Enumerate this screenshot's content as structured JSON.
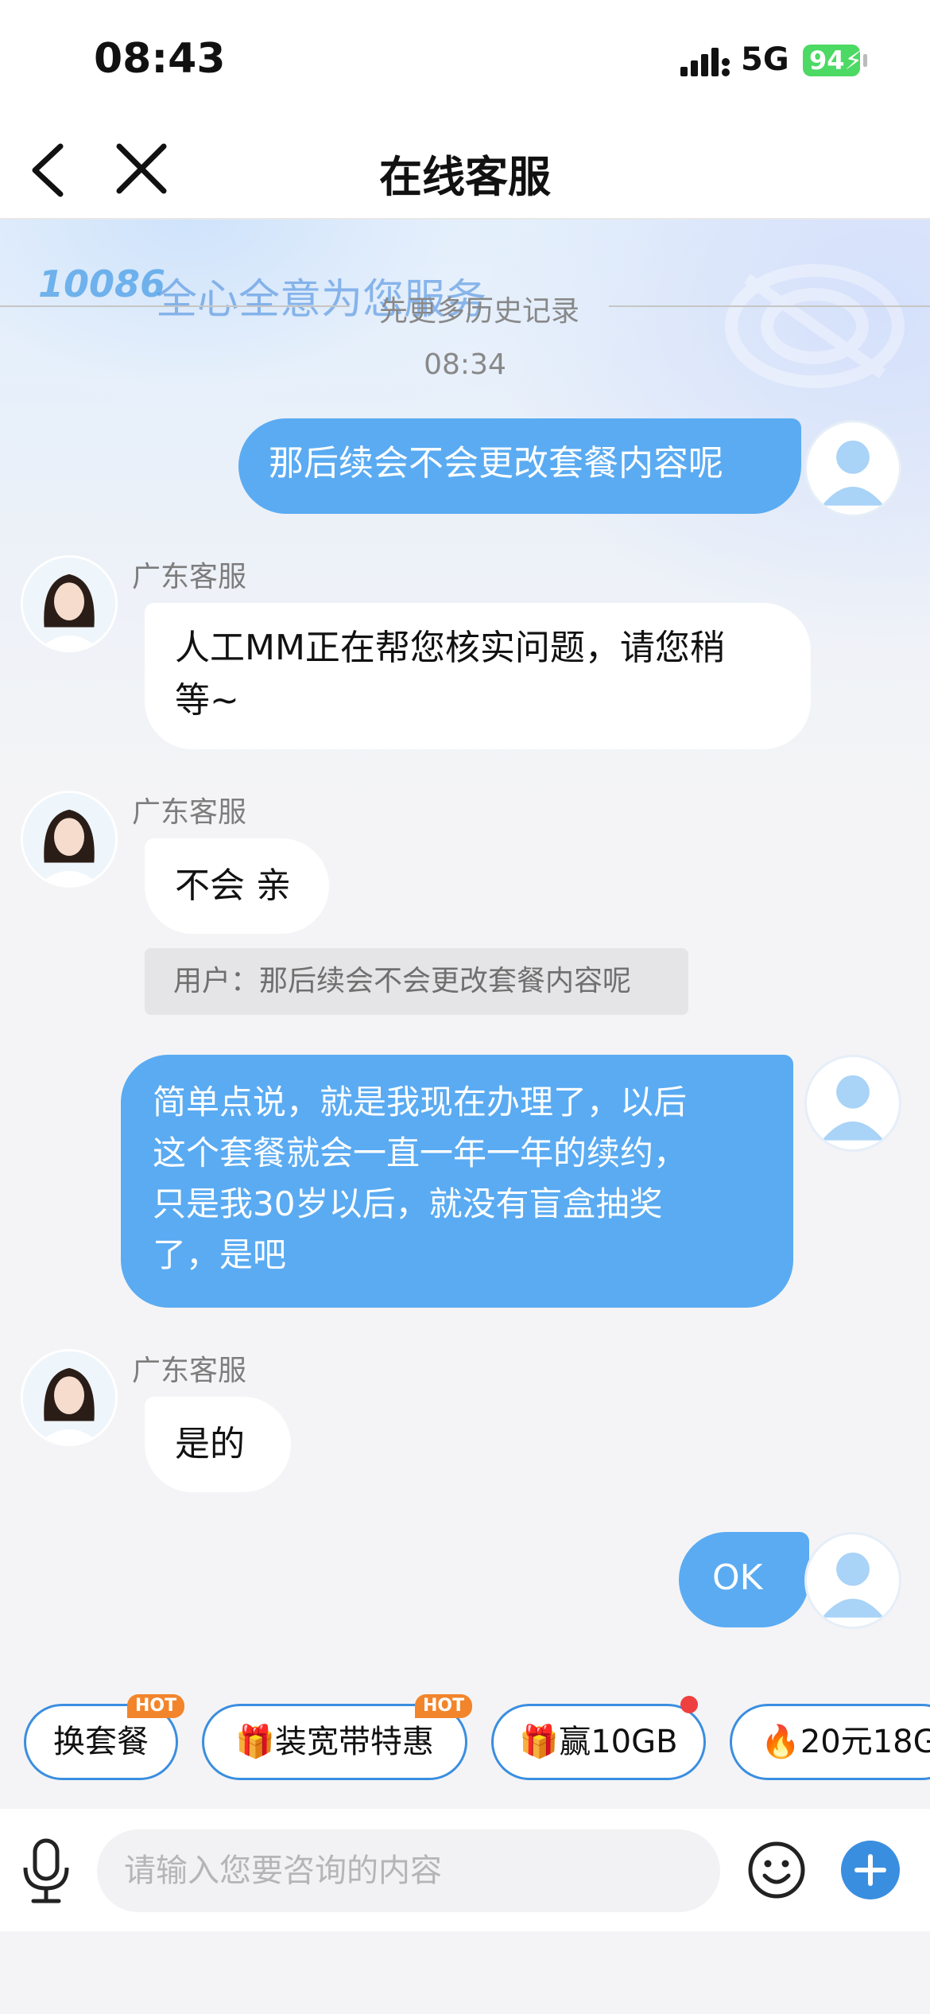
{
  "status_bar": {
    "time": "08:43",
    "network": "5G",
    "battery": "94"
  },
  "nav": {
    "title": "在线客服"
  },
  "banner": {
    "logo_text": "10086",
    "slogan": "全心全意为您服务"
  },
  "history": {
    "label": "先更多历史记录",
    "timestamp": "08:34"
  },
  "messages": [
    {
      "from": "user",
      "text": "那后续会不会更改套餐内容呢"
    },
    {
      "from": "agent",
      "name": "广东客服",
      "lines": [
        "人工MM正在帮您核实问题，请您稍",
        "等~"
      ]
    },
    {
      "from": "agent",
      "name": "广东客服",
      "text": "不会 亲",
      "quote": "用户：那后续会不会更改套餐内容呢"
    },
    {
      "from": "user",
      "lines": [
        "简单点说，就是我现在办理了，以后",
        "这个套餐就会一直一年一年的续约，",
        "只是我30岁以后，就没有盲盒抽奖",
        "了，是吧"
      ]
    },
    {
      "from": "agent",
      "name": "广东客服",
      "text": "是的"
    },
    {
      "from": "user",
      "text": "OK"
    }
  ],
  "quick_chips": [
    {
      "label": "换套餐",
      "badge": "HOT"
    },
    {
      "label": "装宽带特惠",
      "icon": "gift-icon",
      "badge": "HOT"
    },
    {
      "label": "赢10GB",
      "icon": "gift-icon",
      "dot": true
    },
    {
      "label": "20元18G",
      "icon": "fire-icon"
    }
  ],
  "input": {
    "placeholder": "请输入您要咨询的内容"
  },
  "colors": {
    "user_bubble": "#5aabf2",
    "accent": "#3a8ee0",
    "hot_badge": "#f2852b",
    "battery": "#4cd964"
  }
}
